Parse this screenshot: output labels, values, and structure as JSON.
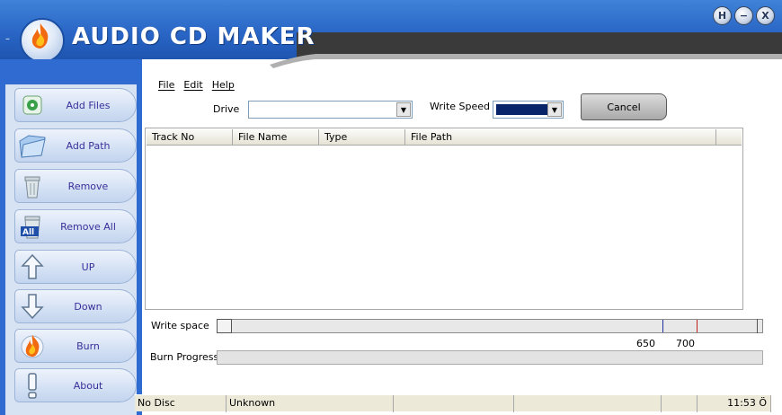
{
  "app": {
    "title": "AUDIO CD MAKER"
  },
  "window_buttons": [
    {
      "name": "help-button",
      "glyph": "H"
    },
    {
      "name": "minimize-button",
      "glyph": "−"
    },
    {
      "name": "close-button",
      "glyph": "X"
    }
  ],
  "sidebar": {
    "items": [
      {
        "label": "Add Files",
        "icon": "add-files-icon"
      },
      {
        "label": "Add Path",
        "icon": "folder-icon"
      },
      {
        "label": "Remove",
        "icon": "trash-icon"
      },
      {
        "label": "Remove All",
        "icon": "trash-all-icon"
      },
      {
        "label": "UP",
        "icon": "arrow-up-icon"
      },
      {
        "label": "Down",
        "icon": "arrow-down-icon"
      },
      {
        "label": "Burn",
        "icon": "flame-icon"
      },
      {
        "label": "About",
        "icon": "exclamation-icon"
      }
    ]
  },
  "menu": {
    "file": "File",
    "edit": "Edit",
    "help": "Help"
  },
  "controls": {
    "drive_label": "Drive",
    "drive_value": "",
    "speed_label": "Write Speed",
    "cancel_label": "Cancel"
  },
  "table": {
    "columns": [
      "Track No",
      "File Name",
      "Type",
      "File Path"
    ],
    "rows": []
  },
  "write_space": {
    "label": "Write space",
    "tick_650": "650",
    "tick_700": "700"
  },
  "burn_progress": {
    "label": "Burn Progress",
    "value": 0
  },
  "status": {
    "disc": "No Disc",
    "type": "Unknown",
    "p3": "",
    "p4": "",
    "p5": "",
    "time": "11:53 Ö"
  },
  "colors": {
    "header_blue": "#2a66c6",
    "accent_purple": "#3a2f9a",
    "speed_selected": "#0a246a"
  }
}
